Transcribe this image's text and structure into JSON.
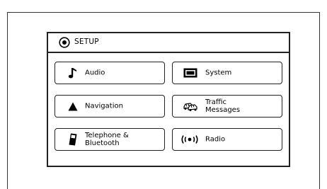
{
  "header": {
    "icon": "gear-icon",
    "title": "SETUP"
  },
  "buttons": {
    "audio": {
      "label": "Audio",
      "icon": "music-note-icon"
    },
    "system": {
      "label": "System",
      "icon": "display-icon"
    },
    "navigation": {
      "label": "Navigation",
      "icon": "arrow-up-icon"
    },
    "traffic": {
      "label": "Traffic\nMessages",
      "icon": "traffic-cars-icon"
    },
    "telephone": {
      "label": "Telephone &\nBluetooth",
      "icon": "phone-icon"
    },
    "radio": {
      "label": "Radio",
      "icon": "radio-waves-icon"
    }
  }
}
